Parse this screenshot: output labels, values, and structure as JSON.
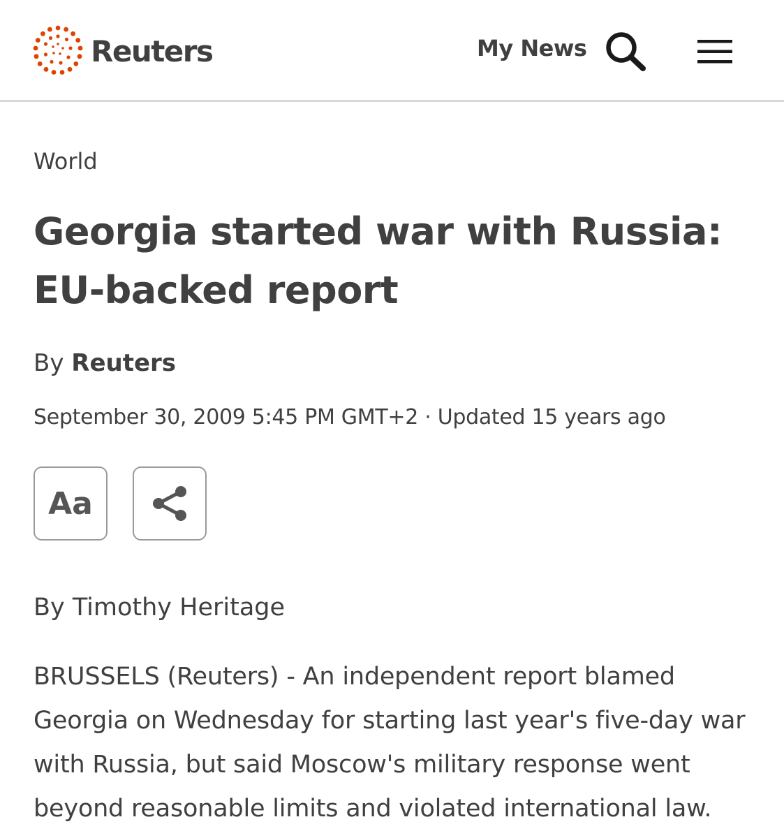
{
  "header": {
    "brand": "Reuters",
    "my_news_label": "My News",
    "search_icon": "search-icon",
    "menu_icon": "hamburger-menu-icon",
    "brand_color": "#dc4405"
  },
  "article": {
    "section": "World",
    "headline": "Georgia started war with Russia: EU-backed report",
    "byline_prefix": "By",
    "byline_author": "Reuters",
    "dateline": "September 30, 2009 5:45 PM GMT+2 · Updated 15 years ago",
    "tools": {
      "font_size_label": "Aa",
      "share_icon": "share-icon"
    },
    "author_line": "By Timothy Heritage",
    "body": "BRUSSELS (Reuters) - An independent report blamed Georgia on Wednesday for starting last year's five-day war with Russia, but said Moscow's military response went beyond reasonable limits and violated international law."
  }
}
